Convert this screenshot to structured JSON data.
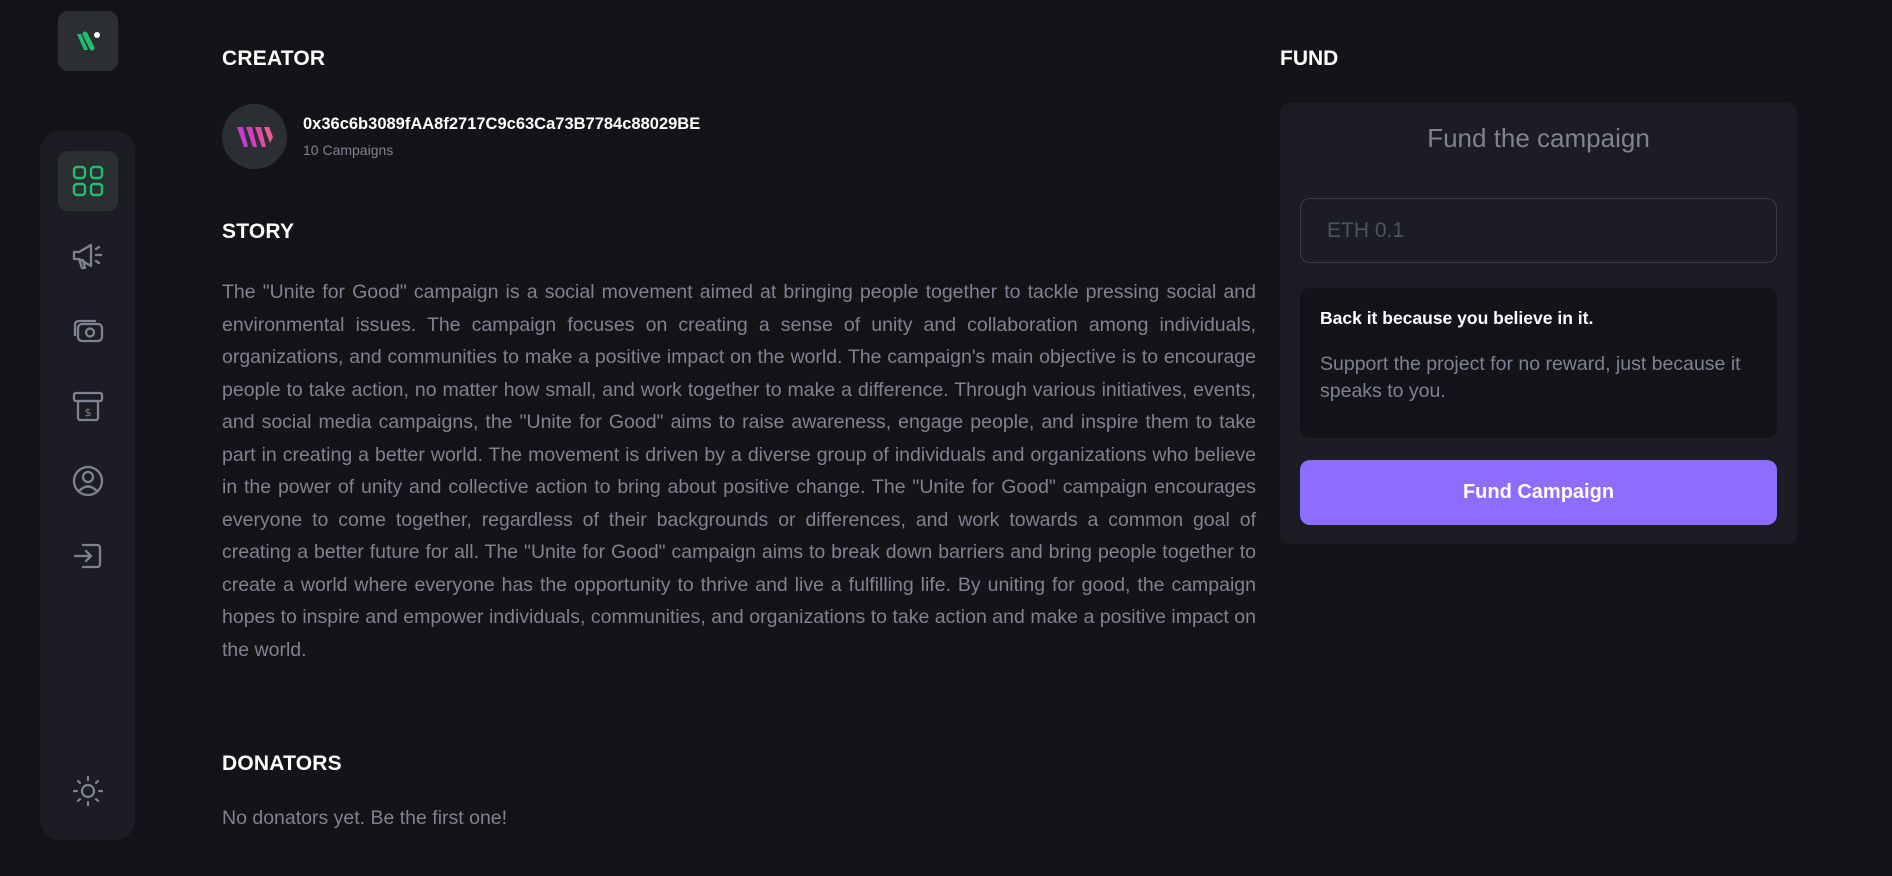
{
  "sidebar": {
    "nav_items": [
      "dashboard",
      "campaign",
      "payment",
      "withdraw",
      "profile",
      "logout"
    ],
    "active_item": "dashboard",
    "accent_color": "#1dc071"
  },
  "creator": {
    "heading": "CREATOR",
    "address": "0x36c6b3089fAA8f2717C9c63Ca73B7784c88029BE",
    "campaigns": "10 Campaigns"
  },
  "story": {
    "heading": "STORY",
    "text": "The \"Unite for Good\" campaign is a social movement aimed at bringing people together to tackle pressing social and environmental issues. The campaign focuses on creating a sense of unity and collaboration among individuals, organizations, and communities to make a positive impact on the world. The campaign's main objective is to encourage people to take action, no matter how small, and work together to make a difference. Through various initiatives, events, and social media campaigns, the \"Unite for Good\" aims to raise awareness, engage people, and inspire them to take part in creating a better world. The movement is driven by a diverse group of individuals and organizations who believe in the power of unity and collective action to bring about positive change. The \"Unite for Good\" campaign encourages everyone to come together, regardless of their backgrounds or differences, and work towards a common goal of creating a better future for all. The \"Unite for Good\" campaign aims to break down barriers and bring people together to create a world where everyone has the opportunity to thrive and live a fulfilling life. By uniting for good, the campaign hopes to inspire and empower individuals, communities, and organizations to take action and make a positive impact on the world."
  },
  "donators": {
    "heading": "DONATORS",
    "empty_text": "No donators yet. Be the first one!"
  },
  "fund": {
    "heading": "FUND",
    "card_title": "Fund the campaign",
    "input_value": "",
    "input_placeholder": "ETH 0.1",
    "info_title": "Back it because you believe in it.",
    "info_desc": "Support the project for no reward, just because it speaks to you.",
    "button_label": "Fund Campaign",
    "button_color": "#8c6dfd"
  }
}
